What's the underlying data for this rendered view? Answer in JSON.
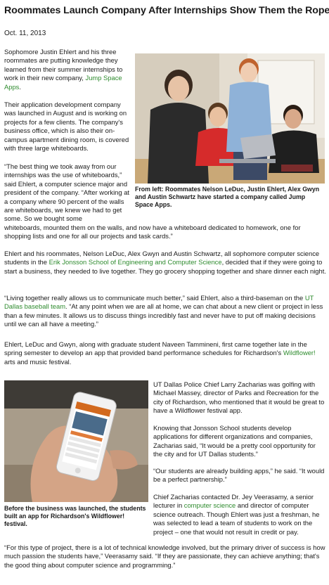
{
  "article": {
    "title": "Roommates Launch Company After Internships Show Them the Ropes",
    "date": "Oct. 11, 2013",
    "p1_before": "Sophomore Justin Ehlert and his three roommates are putting knowledge they learned from their summer internships to work in their new company, ",
    "p1_link": "Jump Space Apps",
    "p1_after": ".",
    "p2": "Their application development company was launched in August and is working on projects for a few clients. The company's business office, which is also their on-campus apartment dining room, is covered with three large whiteboards.",
    "p3a": "“The best thing we took away from our internships was the use of whiteboards,” said Ehlert, a computer science major and president of the company. “After working at a company where 90 percent of the walls are whiteboards, we knew we had to get some. So we bought some",
    "p3b": "whiteboards, mounted them on the walls, and now have a whiteboard dedicated to homework, one for shopping lists and one for all our projects and task cards.”",
    "caption1": "From left: Roommates Nelson LeDuc, Justin Ehlert, Alex Gwyn and Austin Schwartz have started a company called Jump Space Apps.",
    "p4_before": "Ehlert and his roommates, Nelson LeDuc, Alex Gwyn and Austin Schwartz, all sophomore computer science students in the ",
    "p4_link": "Erik Jonsson School of Engineering and Computer Science",
    "p4_after": ", decided that if they were going to start a business, they needed to live together. They go grocery shopping together and share dinner each night.",
    "p5_before": "“Living together really allows us to communicate much better,” said Ehlert, also a third-baseman on the ",
    "p5_link": "UT Dallas baseball team",
    "p5_after": ". “At any point when we are all at home, we can chat about a new client or project in less than a few minutes. It allows us to discuss things incredibly fast and never have to put off making decisions until we can all have a meeting.”",
    "p6_before": "Ehlert, LeDuc and Gwyn, along with graduate student Naveen Tammineni, first came together late in the spring semester to develop an app that provided band performance schedules for Richardson's ",
    "p6_link": "Wildflower!",
    "p6_after": " arts and music festival.",
    "p7": "UT Dallas Police Chief Larry Zacharias was golfing with Michael Massey, director of Parks and Recreation for the city of Richardson, who mentioned that it would be great to have a Wildflower festival app.",
    "p8": "Knowing that Jonsson School students develop applications for different organizations and companies, Zacharias said, “It would be a pretty cool opportunity for the city and for UT Dallas students.”",
    "p9": "“Our students are already building apps,” he said. “It would be a perfect partnership.”",
    "p10_before": "Chief Zacharias contacted Dr. Jey Veerasamy, a senior lecturer in ",
    "p10_link": "computer science",
    "p10_after": " and director of computer science outreach. Though Ehlert was just a freshman, he was selected to lead a team of students to work on the project – one that would not result in credit or pay.",
    "caption2": "Before the business was launched, the students built an app for Richardson's Wildflower! festival.",
    "p11": "“For this type of project, there is a lot of technical knowledge involved, but the primary driver of success is how much passion the students have,” Veerasamy said. “If they are passionate, they can achieve anything; that's the good thing about computer science and programming.”"
  },
  "colors": {
    "link": "#2e8b2e",
    "text": "#1a1a1a"
  }
}
